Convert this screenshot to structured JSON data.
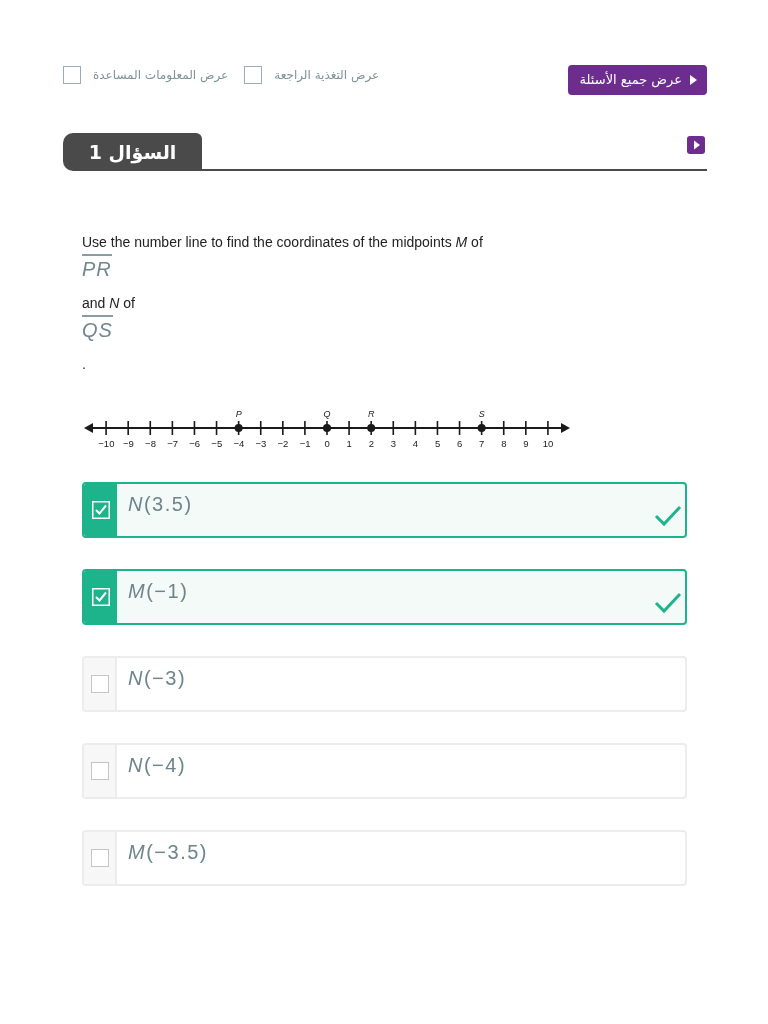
{
  "toolbar": {
    "toggles": [
      {
        "label": "عرض التغذية الراجعة",
        "checked": false
      },
      {
        "label": "عرض المعلومات المساعدة",
        "checked": false
      }
    ],
    "all_questions_button": "عرض جميع الأسئلة"
  },
  "question_tab": "السؤال 1",
  "question": {
    "parts": [
      {
        "kind": "text",
        "text": "Use the number line to find the coordinates of the midpoints *M* of"
      },
      {
        "kind": "segment",
        "text": "PR"
      },
      {
        "kind": "text",
        "text": "and *N* of"
      },
      {
        "kind": "segment",
        "text": "QS"
      },
      {
        "kind": "text",
        "text": "."
      }
    ],
    "number_line": {
      "ticks": [
        {
          "label": "10"
        },
        {
          "label": "9"
        },
        {
          "label": "8"
        },
        {
          "label": "7",
          "point": "S"
        },
        {
          "label": "6"
        },
        {
          "label": "5"
        },
        {
          "label": "4"
        },
        {
          "label": "3"
        },
        {
          "label": "2",
          "point": "R"
        },
        {
          "label": "1"
        },
        {
          "label": "0",
          "point": "Q"
        },
        {
          "label": "−1"
        },
        {
          "label": "−2"
        },
        {
          "label": "−3"
        },
        {
          "label": "−4",
          "point": "P"
        },
        {
          "label": "−5"
        },
        {
          "label": "−6"
        },
        {
          "label": "−7"
        },
        {
          "label": "−8"
        },
        {
          "label": "−9"
        },
        {
          "label": "−10"
        }
      ]
    }
  },
  "options": [
    {
      "text": "*N*(3.5)",
      "checked": true,
      "correct": true
    },
    {
      "text": "*M*(−1)",
      "checked": true,
      "correct": true
    },
    {
      "text": "*N*(−3)",
      "checked": false,
      "correct": false
    },
    {
      "text": "*N*(−4)",
      "checked": false,
      "correct": false
    },
    {
      "text": "*M*(−3.5)",
      "checked": false,
      "correct": false
    }
  ]
}
